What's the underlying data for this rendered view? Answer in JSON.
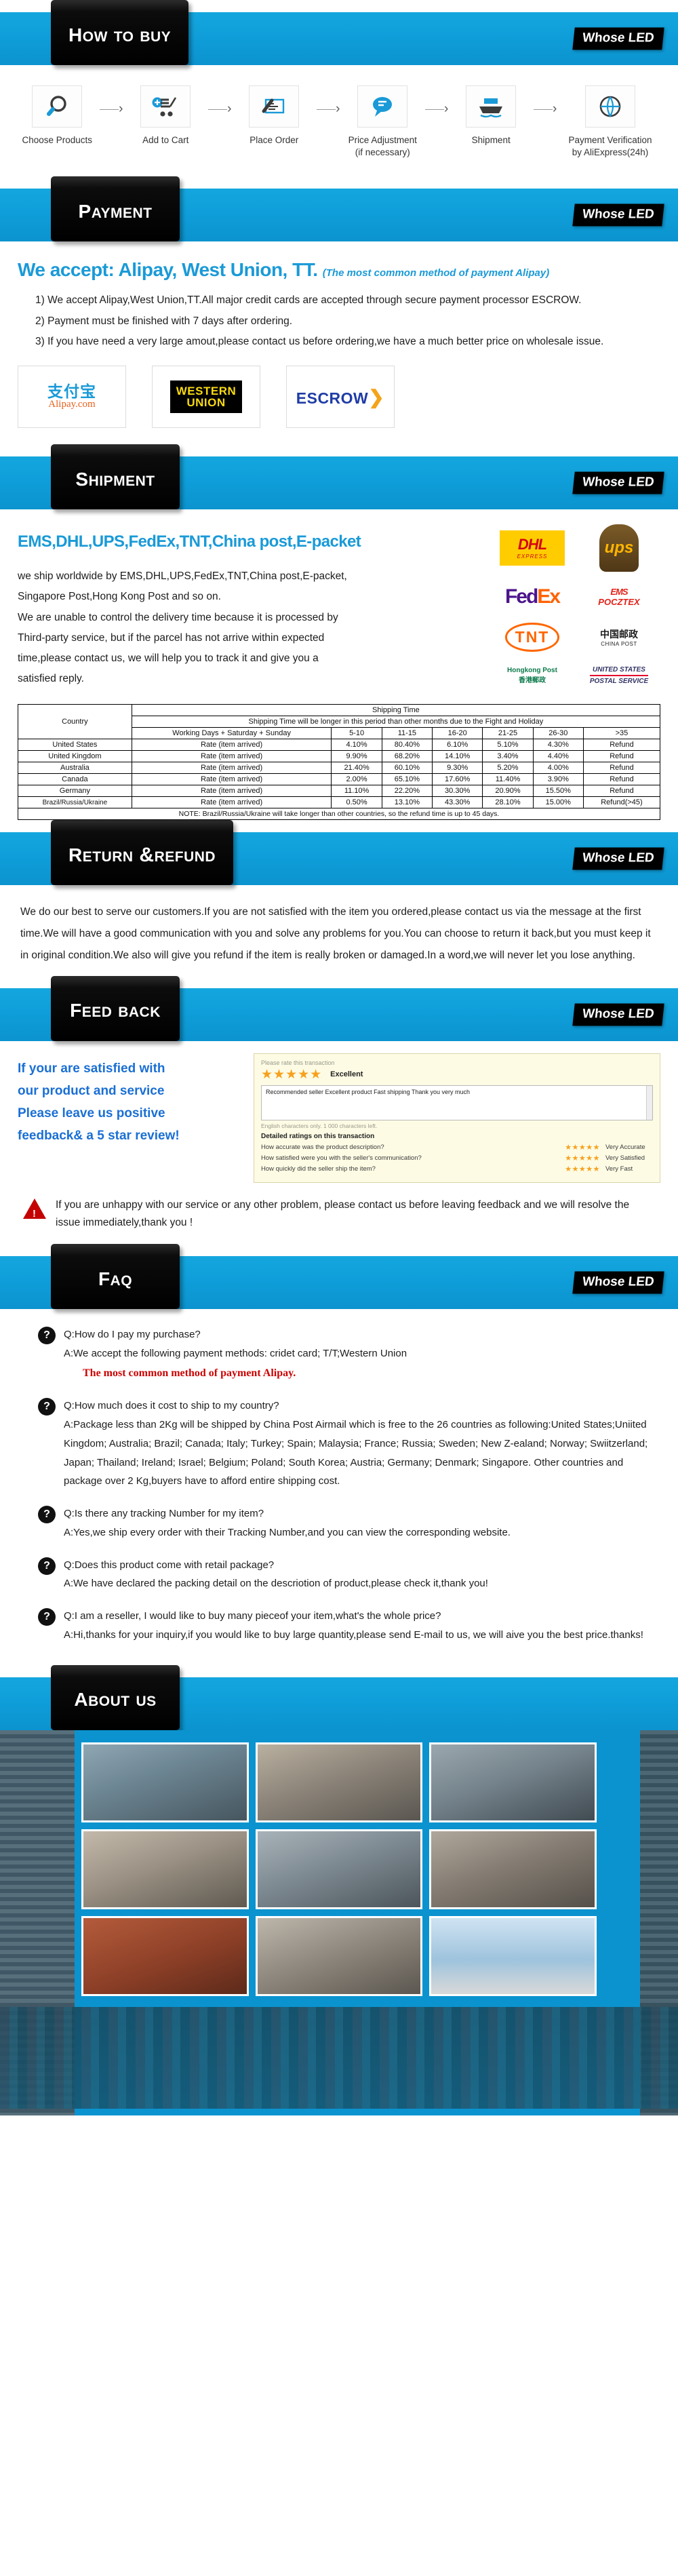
{
  "brand": {
    "badge": "Whose LED"
  },
  "sections": {
    "how_to_buy": {
      "title": "How to buy",
      "steps": [
        {
          "icon": "magnifier-icon",
          "label": "Choose Products"
        },
        {
          "icon": "cart-add-icon",
          "label": "Add to Cart"
        },
        {
          "icon": "place-order-icon",
          "label": "Place Order"
        },
        {
          "icon": "price-adjustment-icon",
          "label": "Price Adjustment\n(if necessary)"
        },
        {
          "icon": "ship-icon",
          "label": "Shipment"
        },
        {
          "icon": "payment-verification-icon",
          "label": "Payment Verification\nby AliExpress(24h)"
        }
      ],
      "step_labels": [
        "Choose Products",
        "Add to Cart",
        "Place Order",
        "Price Adjustment",
        "(if necessary)",
        "Shipment",
        "Payment Verification",
        "by AliExpress(24h)"
      ],
      "arrow": "›"
    },
    "payment": {
      "title": "Payment",
      "headline": "We accept: Alipay, West Union, TT.",
      "headline_sub": "(The most common method of payment Alipay)",
      "items": [
        "1)  We accept Alipay,West Union,TT.All major credit cards are accepted through secure payment processor ESCROW.",
        "2)  Payment must be finished with 7 days after ordering.",
        "3)  If you have need a very large amout,please contact us before ordering,we have a much better price on wholesale issue."
      ],
      "logos": [
        {
          "name": "alipay-logo",
          "cn": "支付宝",
          "en": "Alipay.com"
        },
        {
          "name": "western-union-logo",
          "line1": "WESTERN",
          "line2": "UNION"
        },
        {
          "name": "escrow-logo",
          "text": "ESCROW"
        }
      ]
    },
    "shipment": {
      "title": "Shipment",
      "headline": "EMS,DHL,UPS,FedEx,TNT,China post,E-packet",
      "paragraphs": [
        "we ship worldwide by EMS,DHL,UPS,FedEx,TNT,China post,E-packet,",
        "Singapore Post,Hong Kong Post and so on.",
        "We are unable to control the delivery time because it is processed by",
        "Third-party service, but if the parcel has not arrive within expected",
        "time,please contact us, we will help you to track it and give you a",
        "satisfied reply."
      ],
      "carriers": [
        {
          "name": "dhl-logo",
          "text": "DHL",
          "sub": "EXPRESS"
        },
        {
          "name": "ups-logo",
          "text": "ups"
        },
        {
          "name": "fedex-logo",
          "fe": "Fed",
          "ex": "Ex"
        },
        {
          "name": "ems-pocztex-logo",
          "text": "EMS",
          "sub": "POCZTEX"
        },
        {
          "name": "tnt-logo",
          "text": "TNT"
        },
        {
          "name": "china-post-logo",
          "cn": "中国邮政",
          "en": "CHINA POST"
        },
        {
          "name": "hongkong-post-logo",
          "en": "Hongkong Post",
          "cn": "香港郵政"
        },
        {
          "name": "usps-logo",
          "line1": "UNITED STATES",
          "line2": "POSTAL SERVICE"
        }
      ]
    },
    "return_refund": {
      "title": "Return &Refund",
      "body": "We do our best to serve our customers.If you are not satisfied with the item you ordered,please contact us via the message at the first time.We will have a good communication with you and solve any problems for you.You can choose to return it back,but you must keep it in original condition.We also will give you refund if the item is really broken or damaged.In a word,we will never let you lose anything."
    },
    "feedback": {
      "title": "Feed back",
      "promo_lines": [
        "If  your are satisfied with",
        "our product and service",
        "Please leave us positive",
        "feedback& a 5 star review!"
      ],
      "widget": {
        "hint": "Please rate this transaction",
        "rating_stars": "★★★★★",
        "rating_label": "Excellent",
        "comment": "Recommended seller Excellent product Fast shipping Thank you very much",
        "char_note": "English characters only. 1 000 characters left.",
        "detail_title": "Detailed ratings on this transaction",
        "detail_rows": [
          {
            "question": "How accurate was the product description?",
            "stars": "★★★★★",
            "value": "Very Accurate"
          },
          {
            "question": "How satisfied were you with the seller's communication?",
            "stars": "★★★★★",
            "value": "Very Satisfied"
          },
          {
            "question": "How quickly did the seller ship the item?",
            "stars": "★★★★★",
            "value": "Very Fast"
          }
        ]
      },
      "warning": "If you are unhappy with our service or any other problem, please contact us before leaving feedback and we will resolve the issue immediately,thank you !"
    },
    "faq": {
      "title": "Faq",
      "mark": "?",
      "items": [
        {
          "question": "Q:How do I pay my purchase?",
          "answer": "A:We accept the following payment methods: cridet card; T/T;Western Union",
          "highlight": "The most common method of payment Alipay."
        },
        {
          "question": "Q:How much does it cost to ship to my country?",
          "answer": "A:Package less than 2Kg will be shipped by China Post Airmail which is free  to the 26 countries as following:United States;Uniited Kingdom; Australia; Brazil; Canada; Italy; Turkey; Spain; Malaysia; France; Russia; Sweden; New Z-ealand; Norway; Swiitzerland; Japan; Thailand; Ireland; Israel; Belgium; Poland; South Korea; Austria; Germany; Denmark; Singapore. Other countries and package over 2 Kg,buyers have to afford entire shipping cost.",
          "highlight": ""
        },
        {
          "question": "Q:Is there any tracking Number for my item?",
          "answer": "A:Yes,we ship every order with their Tracking Number,and you can view the corresponding website.",
          "highlight": ""
        },
        {
          "question": "Q:Does this product come with retail package?",
          "answer": "A:We have declared the packing detail on the descriotion of product,please check it,thank you!",
          "highlight": ""
        },
        {
          "question": "Q:I am a reseller, I would like to buy many pieceof your item,what's the whole price?",
          "answer": "A:Hi,thanks for your inquiry,if you would like to buy large quantity,please send E-mail to us, we will aive you the best price.thanks!",
          "highlight": ""
        }
      ]
    },
    "about_us": {
      "title": "About us",
      "photos": [
        "factory-floor-photo",
        "workshop-machines-photo",
        "assembly-line-photo",
        "press-machines-photo",
        "production-hall-photo",
        "warehouse-photo",
        "delivery-truck-photo",
        "storage-racks-photo",
        "cargo-airplane-photo"
      ]
    }
  },
  "shipping_table": {
    "col_country": "Country",
    "group_header": "Shipping Time",
    "sub_header": "Shipping Time will be longer in this period than other months due to the Fight and Holiday",
    "col_days": "Working Days + Saturday + Sunday",
    "columns": [
      "5-10",
      "11-15",
      "16-20",
      "21-25",
      "26-30",
      ">35"
    ],
    "rate_label": "Rate (item arrived)",
    "rows": [
      {
        "country": "United States",
        "values": [
          "4.10%",
          "80.40%",
          "6.10%",
          "5.10%",
          "4.30%",
          "Refund"
        ]
      },
      {
        "country": "United Kingdom",
        "values": [
          "9.90%",
          "68.20%",
          "14.10%",
          "3.40%",
          "4.40%",
          "Refund"
        ]
      },
      {
        "country": "Australia",
        "values": [
          "21.40%",
          "60.10%",
          "9.30%",
          "5.20%",
          "4.00%",
          "Refund"
        ]
      },
      {
        "country": "Canada",
        "values": [
          "2.00%",
          "65.10%",
          "17.60%",
          "11.40%",
          "3.90%",
          "Refund"
        ]
      },
      {
        "country": "Germany",
        "values": [
          "11.10%",
          "22.20%",
          "30.30%",
          "20.90%",
          "15.50%",
          "Refund"
        ]
      },
      {
        "country": "Brazil/Russia/Ukraine",
        "values": [
          "0.50%",
          "13.10%",
          "43.30%",
          "28.10%",
          "15.00%",
          "Refund(>45)"
        ]
      }
    ],
    "note": "NOTE: Brazil/Russia/Ukraine will take longer than other countries, so the refund time is up to 45 days."
  },
  "colors": {
    "accent": "#0b93cf",
    "tab": "#000000",
    "headline": "#1a9ad7",
    "alert": "#cc0000"
  }
}
